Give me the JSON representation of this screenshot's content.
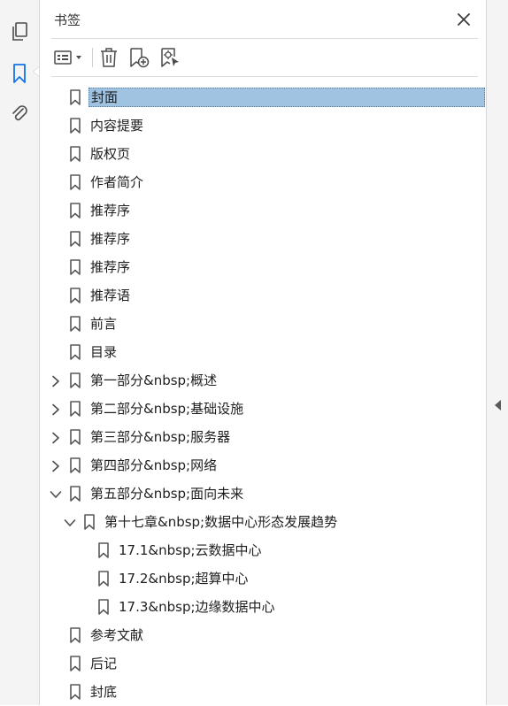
{
  "panel": {
    "title": "书签"
  },
  "sidebar_tools": [
    {
      "name": "pages-icon"
    },
    {
      "name": "bookmarks-icon"
    },
    {
      "name": "attachments-icon"
    }
  ],
  "toolbar": {
    "options_icon": "list-options-icon",
    "delete_icon": "trash-icon",
    "new_bookmark_icon": "new-bookmark-icon",
    "new_bookmark_from_structure_icon": "bookmark-structure-icon"
  },
  "bookmarks": [
    {
      "label": "封面",
      "level": 0,
      "expander": "none",
      "selected": true
    },
    {
      "label": "内容提要",
      "level": 0,
      "expander": "none"
    },
    {
      "label": "版权页",
      "level": 0,
      "expander": "none"
    },
    {
      "label": "作者简介",
      "level": 0,
      "expander": "none"
    },
    {
      "label": "推荐序",
      "level": 0,
      "expander": "none"
    },
    {
      "label": "推荐序",
      "level": 0,
      "expander": "none"
    },
    {
      "label": "推荐序",
      "level": 0,
      "expander": "none"
    },
    {
      "label": "推荐语",
      "level": 0,
      "expander": "none"
    },
    {
      "label": "前言",
      "level": 0,
      "expander": "none"
    },
    {
      "label": "目录",
      "level": 0,
      "expander": "none"
    },
    {
      "label": "第一部分&nbsp;概述",
      "level": 0,
      "expander": "collapsed"
    },
    {
      "label": "第二部分&nbsp;基础设施",
      "level": 0,
      "expander": "collapsed"
    },
    {
      "label": "第三部分&nbsp;服务器",
      "level": 0,
      "expander": "collapsed"
    },
    {
      "label": "第四部分&nbsp;网络",
      "level": 0,
      "expander": "collapsed"
    },
    {
      "label": "第五部分&nbsp;面向未来",
      "level": 0,
      "expander": "expanded"
    },
    {
      "label": "第十七章&nbsp;数据中心形态发展趋势",
      "level": 1,
      "expander": "expanded"
    },
    {
      "label": "17.1&nbsp;云数据中心",
      "level": 2,
      "expander": "none"
    },
    {
      "label": "17.2&nbsp;超算中心",
      "level": 2,
      "expander": "none"
    },
    {
      "label": "17.3&nbsp;边缘数据中心",
      "level": 2,
      "expander": "none"
    },
    {
      "label": "参考文献",
      "level": 0,
      "expander": "none"
    },
    {
      "label": "后记",
      "level": 0,
      "expander": "none"
    },
    {
      "label": "封底",
      "level": 0,
      "expander": "none"
    }
  ],
  "colors": {
    "selection": "#9fc3e0",
    "accent": "#1473e6"
  }
}
